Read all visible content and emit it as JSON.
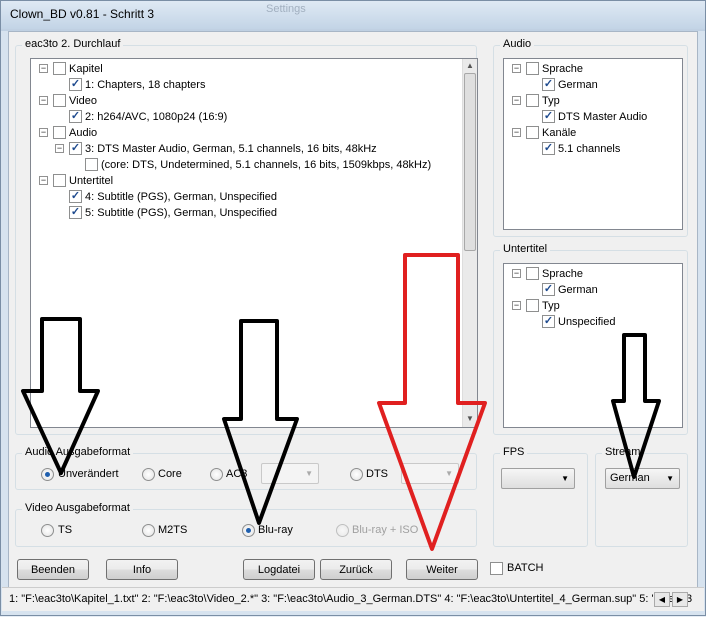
{
  "window": {
    "title": "Clown_BD v0.81 - Schritt 3",
    "ghost_text": "Settings"
  },
  "main_group": {
    "legend": "eac3to 2. Durchlauf",
    "tree": [
      {
        "label": "Kapitel",
        "checked": false,
        "expander": true
      },
      {
        "label": "1: Chapters, 18 chapters",
        "checked": true
      },
      {
        "label": "Video",
        "checked": false,
        "expander": true
      },
      {
        "label": "2: h264/AVC, 1080p24 (16:9)",
        "checked": true
      },
      {
        "label": "Audio",
        "checked": false,
        "expander": true
      },
      {
        "label": "3: DTS Master Audio, German, 5.1 channels, 16 bits, 48kHz",
        "checked": true,
        "expander": true
      },
      {
        "label": "(core: DTS, Undetermined, 5.1 channels, 16 bits, 1509kbps, 48kHz)",
        "checked": false
      },
      {
        "label": "Untertitel",
        "checked": false,
        "expander": true
      },
      {
        "label": "4: Subtitle (PGS), German, Unspecified",
        "checked": true
      },
      {
        "label": "5: Subtitle (PGS), German, Unspecified",
        "checked": true
      }
    ]
  },
  "audio_group": {
    "legend": "Audio",
    "tree": [
      {
        "label": "Sprache",
        "checked": false,
        "expander": true
      },
      {
        "label": "German",
        "checked": true
      },
      {
        "label": "Typ",
        "checked": false,
        "expander": true
      },
      {
        "label": "DTS Master Audio",
        "checked": true
      },
      {
        "label": "Kanäle",
        "checked": false,
        "expander": true
      },
      {
        "label": "5.1 channels",
        "checked": true
      }
    ]
  },
  "subtitle_group": {
    "legend": "Untertitel",
    "tree": [
      {
        "label": "Sprache",
        "checked": false,
        "expander": true
      },
      {
        "label": "German",
        "checked": true
      },
      {
        "label": "Typ",
        "checked": false,
        "expander": true
      },
      {
        "label": "Unspecified",
        "checked": true
      }
    ]
  },
  "audio_format": {
    "legend": "Audio Ausgabeformat",
    "options": [
      {
        "label": "Unverändert",
        "selected": true
      },
      {
        "label": "Core",
        "selected": false
      },
      {
        "label": "AC3",
        "selected": false
      },
      {
        "label": "DTS",
        "selected": false
      }
    ]
  },
  "video_format": {
    "legend": "Video Ausgabeformat",
    "options": [
      {
        "label": "TS",
        "selected": false,
        "disabled": false
      },
      {
        "label": "M2TS",
        "selected": false,
        "disabled": false
      },
      {
        "label": "Blu-ray",
        "selected": true,
        "disabled": false
      },
      {
        "label": "Blu-ray + ISO",
        "selected": false,
        "disabled": true
      }
    ]
  },
  "fps": {
    "legend": "FPS",
    "value": ""
  },
  "stream": {
    "legend": "Stream",
    "value": "German"
  },
  "buttons": {
    "beenden": "Beenden",
    "info": "Info",
    "logdatei": "Logdatei",
    "zurueck": "Zurück",
    "weiter": "Weiter",
    "batch": "BATCH"
  },
  "status_text": "1: \"F:\\eac3to\\Kapitel_1.txt\" 2: \"F:\\eac3to\\Video_2.*\" 3: \"F:\\eac3to\\Audio_3_German.DTS\" 4: \"F:\\eac3to\\Untertitel_4_German.sup\" 5: \"F:\\eac3",
  "annotation_colors": {
    "black_arrows": "#000000",
    "red_arrow": "#e02020"
  }
}
